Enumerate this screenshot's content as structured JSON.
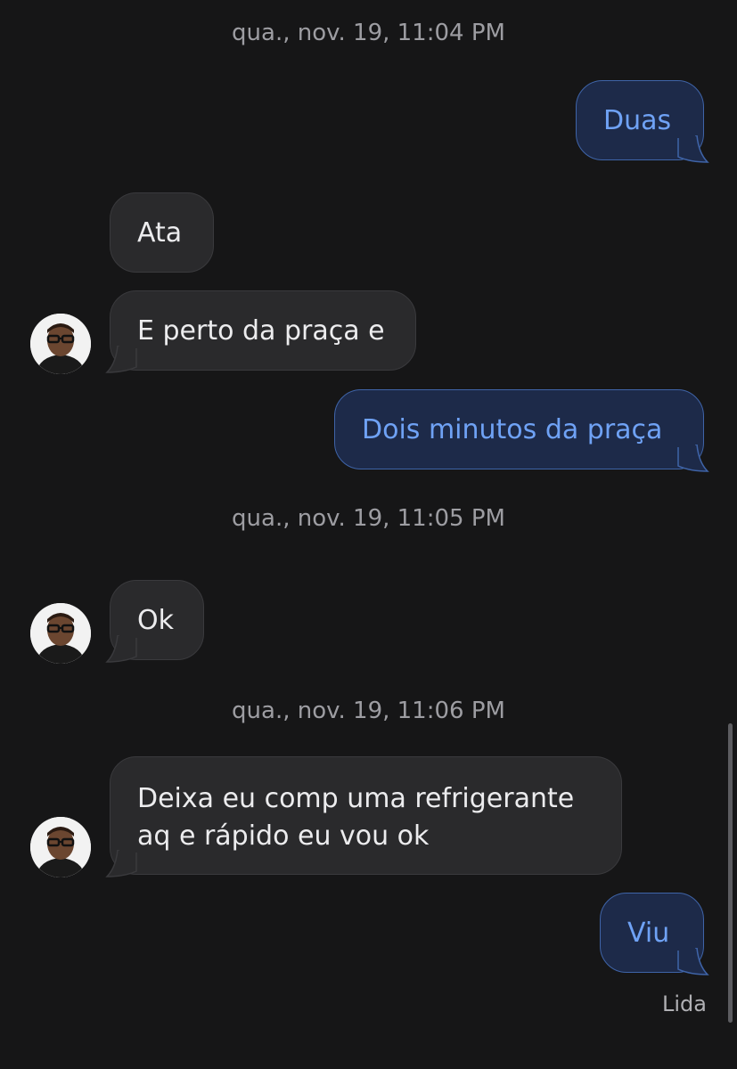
{
  "timestamps": [
    "qua., nov. 19, 11:04 PM",
    "qua., nov. 19, 11:05 PM",
    "qua., nov. 19, 11:06 PM"
  ],
  "messages": [
    {
      "direction": "outgoing",
      "text": "Duas"
    },
    {
      "direction": "incoming",
      "text": "Ata"
    },
    {
      "direction": "incoming",
      "text": "E perto da praça e"
    },
    {
      "direction": "outgoing",
      "text": "Dois minutos da praça"
    },
    {
      "direction": "incoming",
      "text": "Ok"
    },
    {
      "direction": "incoming",
      "lines": [
        "Deixa eu comp uma refrigerante",
        "aq e rápido eu vou ok"
      ]
    },
    {
      "direction": "outgoing",
      "text": "Viu"
    }
  ],
  "read_receipt": "Lida",
  "colors": {
    "background": "#161617",
    "incoming_bubble": "#2a2a2c",
    "outgoing_bubble": "#1d2a49",
    "outgoing_border": "#3f64a8",
    "outgoing_text": "#6fa2f5"
  },
  "icons": [
    "contact-avatar"
  ]
}
